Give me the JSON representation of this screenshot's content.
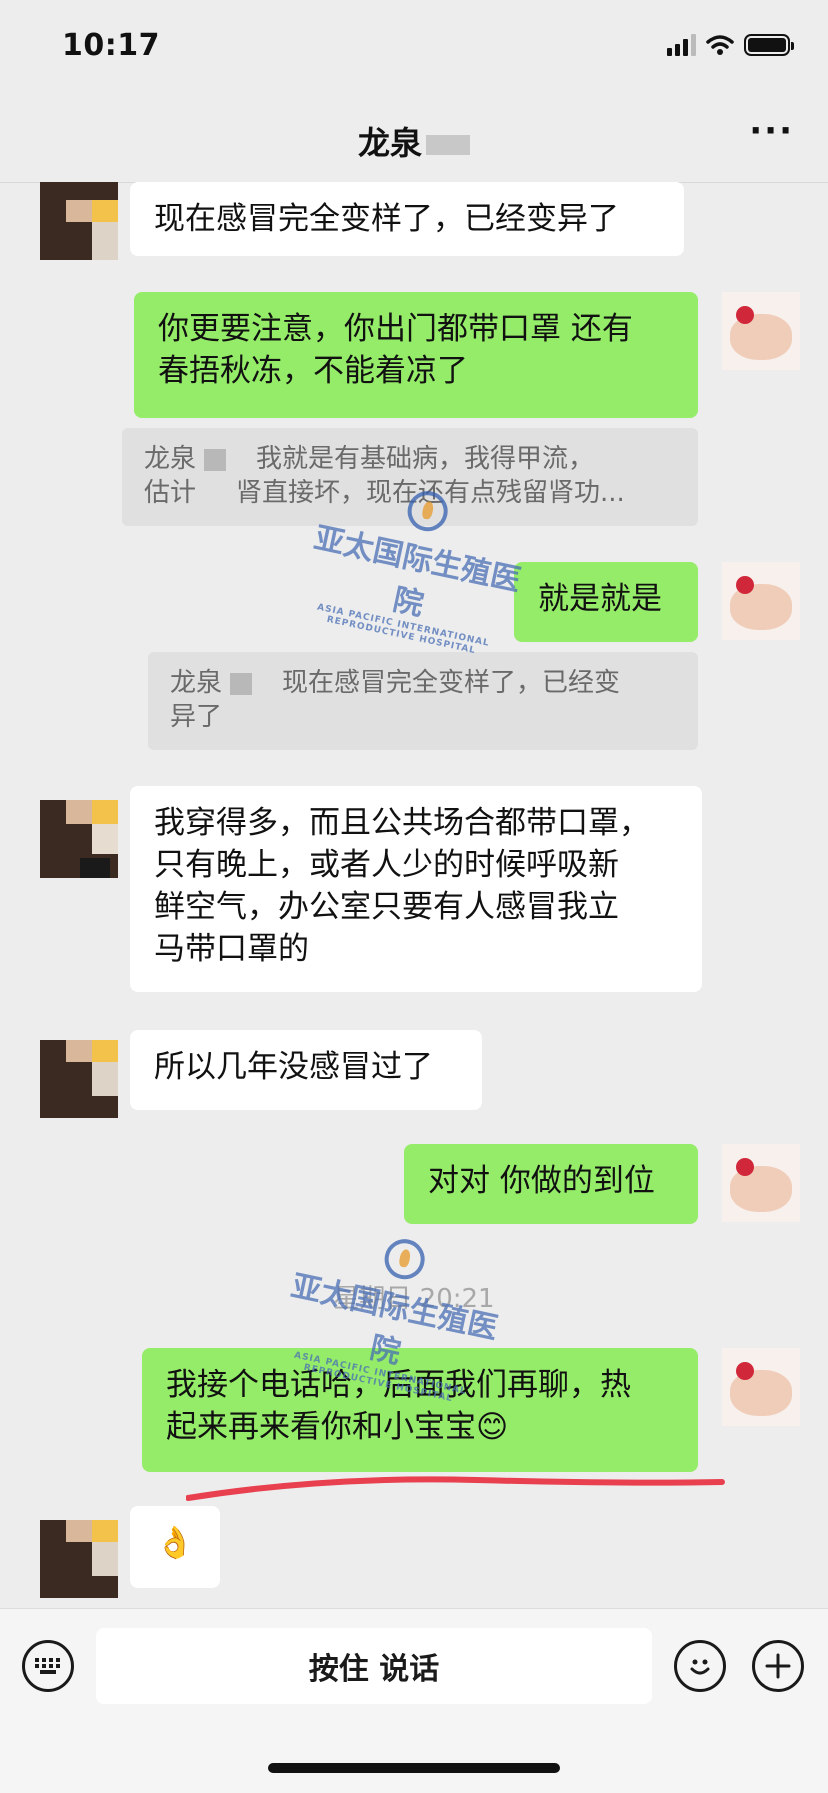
{
  "status_bar": {
    "time": "10:17"
  },
  "header": {
    "title": "龙泉"
  },
  "messages": [
    {
      "side": "left",
      "text": "现在感冒完全变样了，已经变异了"
    },
    {
      "side": "right",
      "line1": "你更要注意，你出门都带口罩 还有",
      "line2": "春捂秋冻，不能着凉了"
    },
    {
      "type": "quote",
      "name": "龙泉",
      "line1": "我就是有基础病，我得甲流，",
      "line2a": "估计",
      "line2b": "肾直接坏，现在还有点残留肾功..."
    },
    {
      "side": "right",
      "text": "就是就是"
    },
    {
      "type": "quote",
      "name": "龙泉",
      "line1": "现在感冒完全变样了，已经变",
      "line2": "异了"
    },
    {
      "side": "left",
      "line1": "我穿得多，而且公共场合都带口罩，",
      "line2": "只有晚上，或者人少的时候呼吸新",
      "line3": "鲜空气，办公室只要有人感冒我立",
      "line4": "马带口罩的"
    },
    {
      "side": "left",
      "text": "所以几年没感冒过了"
    },
    {
      "side": "right",
      "text": "对对 你做的到位"
    },
    {
      "type": "timestamp",
      "text": "星期日 20:21"
    },
    {
      "side": "right",
      "line1": "我接个电话哈，后面我们再聊，热",
      "line2": "起来再来看你和小宝宝😊"
    },
    {
      "side": "left",
      "text": "👌"
    }
  ],
  "watermark": {
    "text": "亚太国际生殖医院",
    "subtext": "ASIA PACIFIC INTERNATIONAL REPRODUCTIVE HOSPITAL"
  },
  "input_bar": {
    "voice_label": "按住 说话"
  },
  "colors": {
    "background": "#ededed",
    "bubble_self": "#95ec69",
    "bubble_other": "#ffffff",
    "underline": "#e8404f",
    "watermark": "#4a6fb5"
  }
}
